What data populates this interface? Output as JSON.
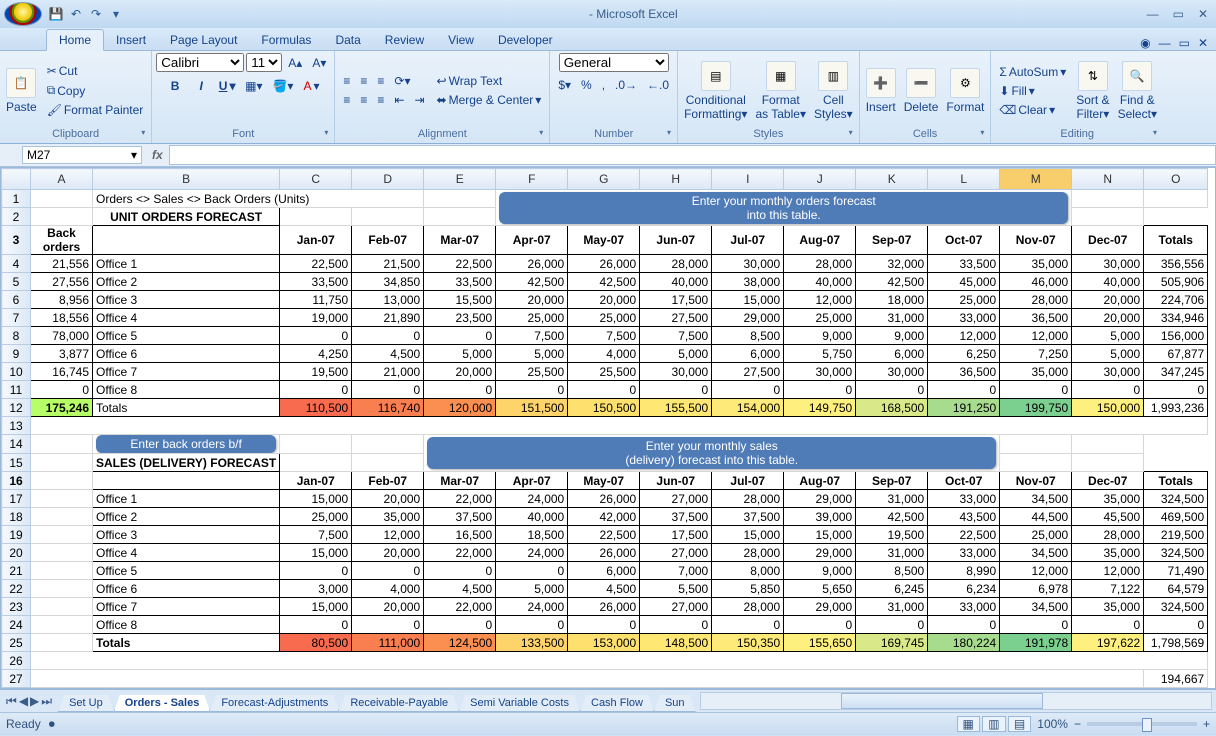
{
  "app": {
    "title_suffix": " - Microsoft Excel"
  },
  "qat": {
    "save": "💾",
    "undo": "↶",
    "redo": "↷"
  },
  "tabs": [
    "Home",
    "Insert",
    "Page Layout",
    "Formulas",
    "Data",
    "Review",
    "View",
    "Developer"
  ],
  "ribbon": {
    "clipboard": {
      "paste": "Paste",
      "cut": "Cut",
      "copy": "Copy",
      "fp": "Format Painter",
      "label": "Clipboard"
    },
    "font": {
      "name": "Calibri",
      "size": "11",
      "label": "Font"
    },
    "alignment": {
      "wrap": "Wrap Text",
      "merge": "Merge & Center",
      "label": "Alignment"
    },
    "number": {
      "format": "General",
      "label": "Number"
    },
    "styles": {
      "cf": "Conditional",
      "cf2": "Formatting",
      "fat": "Format",
      "fat2": "as Table",
      "cs": "Cell",
      "cs2": "Styles",
      "label": "Styles"
    },
    "cells": {
      "ins": "Insert",
      "del": "Delete",
      "fmt": "Format",
      "label": "Cells"
    },
    "editing": {
      "sum": "AutoSum",
      "fill": "Fill",
      "clear": "Clear",
      "sort": "Sort &",
      "sort2": "Filter",
      "find": "Find &",
      "find2": "Select",
      "label": "Editing"
    }
  },
  "namebox": "M27",
  "cols": [
    "A",
    "B",
    "C",
    "D",
    "E",
    "F",
    "G",
    "H",
    "I",
    "J",
    "K",
    "L",
    "M",
    "N",
    "O"
  ],
  "selcol": "M",
  "r1": {
    "b": "Orders <> Sales <> Back Orders (Units)",
    "callout1": "Enter your monthly orders forecast"
  },
  "r2": {
    "b": "UNIT ORDERS FORECAST",
    "callout2": "into this table."
  },
  "back": "Back",
  "orders": "orders",
  "months": [
    "Jan-07",
    "Feb-07",
    "Mar-07",
    "Apr-07",
    "May-07",
    "Jun-07",
    "Jul-07",
    "Aug-07",
    "Sep-07",
    "Oct-07",
    "Nov-07",
    "Dec-07"
  ],
  "totals_h": "Totals",
  "offices": [
    {
      "bo": "21,556",
      "name": "Office 1",
      "v": [
        "22,500",
        "21,500",
        "22,500",
        "26,000",
        "26,000",
        "28,000",
        "30,000",
        "28,000",
        "32,000",
        "33,500",
        "35,000",
        "30,000"
      ],
      "t": "356,556"
    },
    {
      "bo": "27,556",
      "name": "Office 2",
      "v": [
        "33,500",
        "34,850",
        "33,500",
        "42,500",
        "42,500",
        "40,000",
        "38,000",
        "40,000",
        "42,500",
        "45,000",
        "46,000",
        "40,000"
      ],
      "t": "505,906"
    },
    {
      "bo": "8,956",
      "name": "Office 3",
      "v": [
        "11,750",
        "13,000",
        "15,500",
        "20,000",
        "20,000",
        "17,500",
        "15,000",
        "12,000",
        "18,000",
        "25,000",
        "28,000",
        "20,000"
      ],
      "t": "224,706"
    },
    {
      "bo": "18,556",
      "name": "Office 4",
      "v": [
        "19,000",
        "21,890",
        "23,500",
        "25,000",
        "25,000",
        "27,500",
        "29,000",
        "25,000",
        "31,000",
        "33,000",
        "36,500",
        "20,000"
      ],
      "t": "334,946"
    },
    {
      "bo": "78,000",
      "name": "Office 5",
      "v": [
        "0",
        "0",
        "0",
        "7,500",
        "7,500",
        "7,500",
        "8,500",
        "9,000",
        "9,000",
        "12,000",
        "12,000",
        "5,000"
      ],
      "t": "156,000"
    },
    {
      "bo": "3,877",
      "name": "Office 6",
      "v": [
        "4,250",
        "4,500",
        "5,000",
        "5,000",
        "4,000",
        "5,000",
        "6,000",
        "5,750",
        "6,000",
        "6,250",
        "7,250",
        "5,000"
      ],
      "t": "67,877"
    },
    {
      "bo": "16,745",
      "name": "Office 7",
      "v": [
        "19,500",
        "21,000",
        "20,000",
        "25,500",
        "25,500",
        "30,000",
        "27,500",
        "30,000",
        "30,000",
        "36,500",
        "35,000",
        "30,000"
      ],
      "t": "347,245"
    },
    {
      "bo": "0",
      "name": "Office 8",
      "v": [
        "0",
        "0",
        "0",
        "0",
        "0",
        "0",
        "0",
        "0",
        "0",
        "0",
        "0",
        "0"
      ],
      "t": "0"
    }
  ],
  "ot": {
    "bo": "175,246",
    "name": "Totals",
    "v": [
      "110,500",
      "116,740",
      "120,000",
      "151,500",
      "150,500",
      "155,500",
      "154,000",
      "149,750",
      "168,500",
      "191,250",
      "199,750",
      "150,000"
    ],
    "t": "1,993,236"
  },
  "callout3": "Enter back orders b/f",
  "callout4a": "Enter your monthly sales",
  "callout4b": "(delivery) forecast into this table.",
  "sales_h": "SALES (DELIVERY) FORECAST",
  "sales": [
    {
      "name": "Office 1",
      "v": [
        "15,000",
        "20,000",
        "22,000",
        "24,000",
        "26,000",
        "27,000",
        "28,000",
        "29,000",
        "31,000",
        "33,000",
        "34,500",
        "35,000"
      ],
      "t": "324,500"
    },
    {
      "name": "Office 2",
      "v": [
        "25,000",
        "35,000",
        "37,500",
        "40,000",
        "42,000",
        "37,500",
        "37,500",
        "39,000",
        "42,500",
        "43,500",
        "44,500",
        "45,500"
      ],
      "t": "469,500"
    },
    {
      "name": "Office 3",
      "v": [
        "7,500",
        "12,000",
        "16,500",
        "18,500",
        "22,500",
        "17,500",
        "15,000",
        "15,000",
        "19,500",
        "22,500",
        "25,000",
        "28,000"
      ],
      "t": "219,500"
    },
    {
      "name": "Office 4",
      "v": [
        "15,000",
        "20,000",
        "22,000",
        "24,000",
        "26,000",
        "27,000",
        "28,000",
        "29,000",
        "31,000",
        "33,000",
        "34,500",
        "35,000"
      ],
      "t": "324,500"
    },
    {
      "name": "Office 5",
      "v": [
        "0",
        "0",
        "0",
        "0",
        "6,000",
        "7,000",
        "8,000",
        "9,000",
        "8,500",
        "8,990",
        "12,000",
        "12,000"
      ],
      "t": "71,490"
    },
    {
      "name": "Office 6",
      "v": [
        "3,000",
        "4,000",
        "4,500",
        "5,000",
        "4,500",
        "5,500",
        "5,850",
        "5,650",
        "6,245",
        "6,234",
        "6,978",
        "7,122"
      ],
      "t": "64,579"
    },
    {
      "name": "Office 7",
      "v": [
        "15,000",
        "20,000",
        "22,000",
        "24,000",
        "26,000",
        "27,000",
        "28,000",
        "29,000",
        "31,000",
        "33,000",
        "34,500",
        "35,000"
      ],
      "t": "324,500"
    },
    {
      "name": "Office 8",
      "v": [
        "0",
        "0",
        "0",
        "0",
        "0",
        "0",
        "0",
        "0",
        "0",
        "0",
        "0",
        "0"
      ],
      "t": "0"
    }
  ],
  "st": {
    "name": "Totals",
    "v": [
      "80,500",
      "111,000",
      "124,500",
      "133,500",
      "153,000",
      "148,500",
      "150,350",
      "155,650",
      "169,745",
      "180,224",
      "191,978",
      "197,622"
    ],
    "t": "1,798,569"
  },
  "r27": "194,667",
  "sheets": [
    "Set Up",
    "Orders - Sales",
    "Forecast-Adjustments",
    "Receivable-Payable",
    "Semi Variable Costs",
    "Cash Flow",
    "Sun"
  ],
  "active_sheet": 1,
  "status": {
    "ready": "Ready",
    "rec": "",
    "zoom": "100%"
  }
}
